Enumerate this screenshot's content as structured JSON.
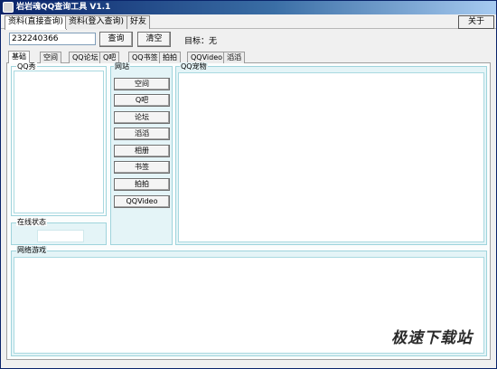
{
  "window": {
    "title": "岩岩魂QQ查询工具 V1.1"
  },
  "top_tabs": [
    {
      "label": "资料(直接查询)",
      "active": true
    },
    {
      "label": "资料(登入查询)",
      "active": false
    },
    {
      "label": "好友",
      "active": false
    }
  ],
  "about_label": "关于",
  "query": {
    "value": "232240366",
    "query_label": "查询",
    "clear_label": "清空",
    "target_text": "目标：无"
  },
  "inner_tabs": [
    {
      "label": "基础",
      "active": true
    },
    {
      "label": "空间"
    },
    {
      "label": "QQ论坛"
    },
    {
      "label": "Q吧"
    },
    {
      "label": "QQ书签"
    },
    {
      "label": "拍拍"
    },
    {
      "label": "QQVideo"
    },
    {
      "label": "滔滔"
    }
  ],
  "groups": {
    "qq_show": "QQ秀",
    "online_status": "在线状态",
    "website": "网站",
    "qq_pet": "QQ宠物",
    "online_games": "网络游戏"
  },
  "website_buttons": [
    "空间",
    "Q吧",
    "论坛",
    "滔滔",
    "相册",
    "书签",
    "拍拍",
    "QQVideo"
  ],
  "watermark": "极速下载站"
}
